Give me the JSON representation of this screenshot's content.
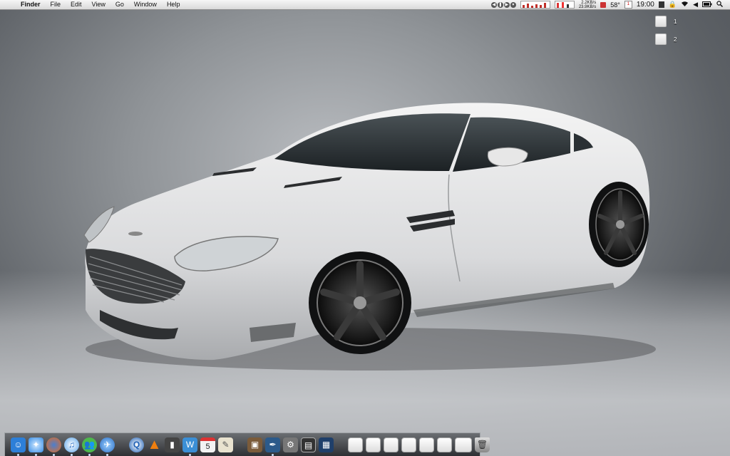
{
  "menubar": {
    "apple_glyph": "",
    "app_name": "Finder",
    "menus": [
      "File",
      "Edit",
      "View",
      "Go",
      "Window",
      "Help"
    ],
    "net_up": "2.2KB/s",
    "net_down": "23.9KB/s",
    "temperature": "58°",
    "calendar_day": "1",
    "clock": "19:00"
  },
  "desktop": {
    "icons": [
      {
        "label": "1"
      },
      {
        "label": "2"
      }
    ]
  },
  "dock": {
    "apps": [
      {
        "name": "finder-icon",
        "color": "#2d7fd8"
      },
      {
        "name": "safari-icon",
        "color": "#3a8ee6"
      },
      {
        "name": "firefox-icon",
        "color": "#e56b1f"
      },
      {
        "name": "itunes-icon",
        "color": "#5aa3e8"
      },
      {
        "name": "messenger-icon",
        "color": "#4db84d"
      },
      {
        "name": "facetime-icon",
        "color": "#2a6ec5"
      },
      {
        "name": "quicktime-icon",
        "color": "#1d5fb5"
      },
      {
        "name": "vlc-icon",
        "color": "#f07f0f"
      },
      {
        "name": "textmate-icon",
        "color": "#444"
      },
      {
        "name": "wordpress-icon",
        "color": "#3b8fd6"
      },
      {
        "name": "ical-icon",
        "color": "#f3f3f3"
      },
      {
        "name": "textedit-icon",
        "color": "#e9e2cf"
      },
      {
        "name": "preview-icon",
        "color": "#7b5b3a"
      },
      {
        "name": "script-editor-icon",
        "color": "#2c5a8a"
      },
      {
        "name": "utility-icon",
        "color": "#777"
      },
      {
        "name": "system-monitor-icon",
        "color": "#333"
      },
      {
        "name": "terminal-icon",
        "color": "#1f3f6a"
      }
    ],
    "calendar_day": "5"
  }
}
